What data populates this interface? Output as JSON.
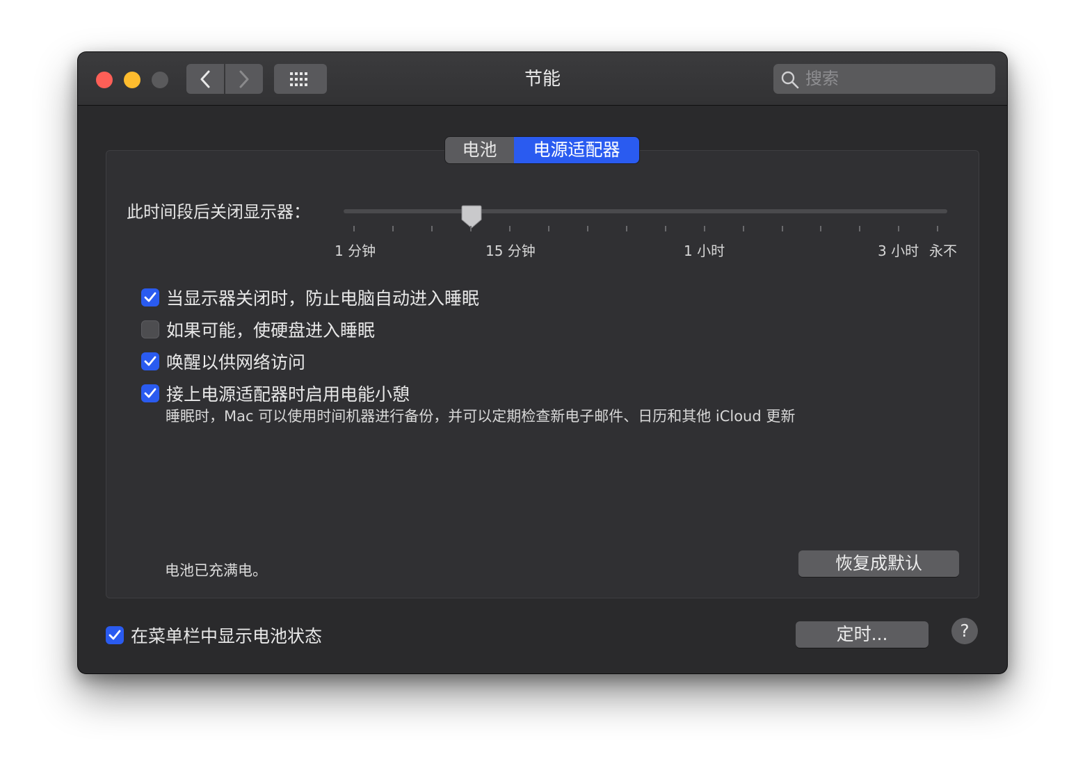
{
  "window": {
    "title": "节能"
  },
  "search": {
    "placeholder": "搜索"
  },
  "tabs": [
    {
      "label": "电池",
      "selected": false
    },
    {
      "label": "电源适配器",
      "selected": true
    }
  ],
  "display_sleep": {
    "label": "此时间段后关闭显示器：",
    "value": "15 分钟",
    "tick_labels": [
      "1 分钟",
      "15 分钟",
      "1 小时",
      "3 小时",
      "永不"
    ]
  },
  "options": [
    {
      "label": "当显示器关闭时，防止电脑自动进入睡眠",
      "checked": true
    },
    {
      "label": "如果可能，使硬盘进入睡眠",
      "checked": false
    },
    {
      "label": "唤醒以供网络访问",
      "checked": true
    },
    {
      "label": "接上电源适配器时启用电能小憩",
      "checked": true
    }
  ],
  "power_nap_description": "睡眠时，Mac 可以使用时间机器进行备份，并可以定期检查新电子邮件、日历和其他 iCloud 更新",
  "battery_status": "电池已充满电。",
  "buttons": {
    "restore_defaults": "恢复成默认",
    "schedule": "定时...",
    "help": "?"
  },
  "menubar_option": {
    "label": "在菜单栏中显示电池状态",
    "checked": true
  },
  "colors": {
    "accent": "#2a5bf0",
    "window_bg": "#2a2a2c",
    "close": "#fe5f57",
    "minimize": "#febc2e"
  },
  "icons": [
    "back-chevron-icon",
    "forward-chevron-icon",
    "grid-icon",
    "search-icon",
    "checkmark-icon",
    "slider-thumb"
  ]
}
